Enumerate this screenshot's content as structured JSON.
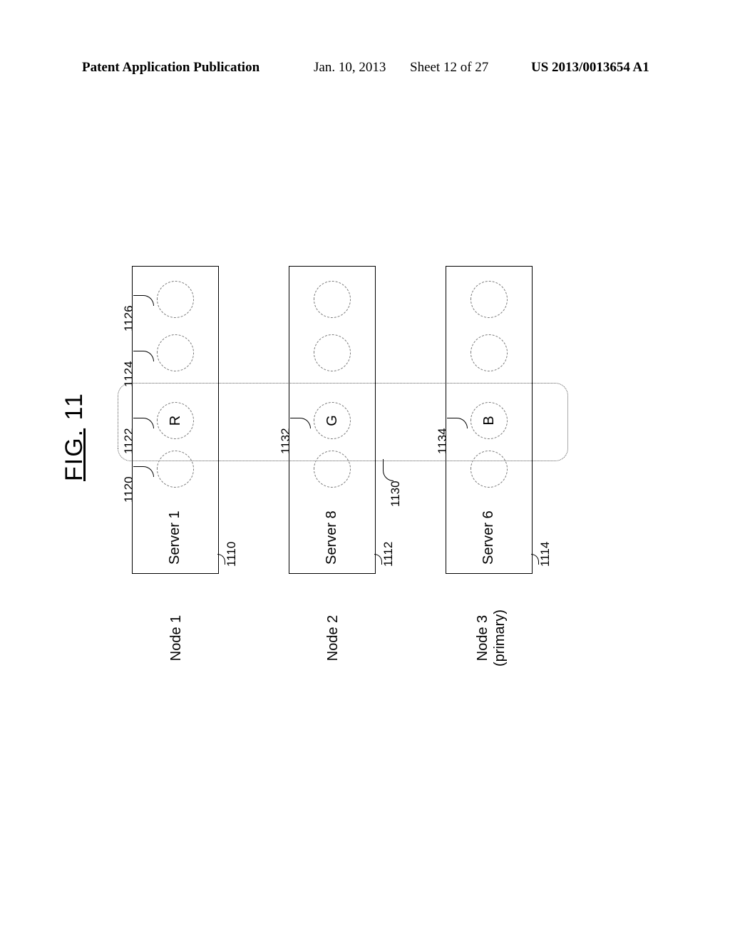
{
  "header": {
    "publication": "Patent Application Publication",
    "date": "Jan. 10, 2013",
    "sheet": "Sheet 12 of 27",
    "docnum": "US 2013/0013654 A1"
  },
  "figure": {
    "title_prefix": "FIG.",
    "title_num": "11"
  },
  "nodes": {
    "n1": {
      "label": "Node 1",
      "sub": ""
    },
    "n2": {
      "label": "Node 2",
      "sub": ""
    },
    "n3": {
      "label": "Node 3",
      "sub": "(primary)"
    }
  },
  "servers": {
    "s1": {
      "name": "Server 1"
    },
    "s2": {
      "name": "Server 8"
    },
    "s3": {
      "name": "Server 6"
    }
  },
  "slots": {
    "r": "R",
    "g": "G",
    "b": "B"
  },
  "refs": {
    "r1110": "1110",
    "r1112": "1112",
    "r1114": "1114",
    "r1120": "1120",
    "r1122": "1122",
    "r1124": "1124",
    "r1126": "1126",
    "r1130": "1130",
    "r1132": "1132",
    "r1134": "1134"
  }
}
